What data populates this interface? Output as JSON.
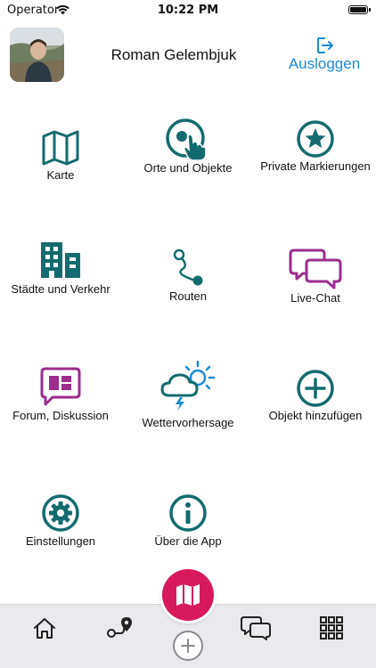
{
  "status_bar": {
    "carrier": "Operator",
    "time": "10:22 PM"
  },
  "header": {
    "user_name": "Roman Gelembjuk",
    "logout_label": "Ausloggen"
  },
  "colors": {
    "teal": "#146b6e",
    "purple": "#9b2d8e",
    "accent_blue": "#1c8ad9",
    "fab": "#d81a5c",
    "bar_bg": "#e9e9ee"
  },
  "menu": {
    "map": {
      "label": "Karte",
      "icon": "map-icon"
    },
    "places": {
      "label": "Orte und Objekte",
      "icon": "place-tap-icon"
    },
    "markers": {
      "label": "Private Markierungen",
      "icon": "star-icon"
    },
    "cities": {
      "label": "Städte und Verkehr",
      "icon": "buildings-icon"
    },
    "routes": {
      "label": "Routen",
      "icon": "route-icon"
    },
    "chat": {
      "label": "Live-Chat",
      "icon": "chat-icon"
    },
    "forum": {
      "label": "Forum, Diskussion",
      "icon": "forum-icon"
    },
    "weather": {
      "label": "Wettervorhersage",
      "icon": "weather-icon"
    },
    "add_object": {
      "label": "Objekt hinzufügen",
      "icon": "plus-circle-icon"
    },
    "settings": {
      "label": "Einstellungen",
      "icon": "gear-icon"
    },
    "about": {
      "label": "Über die App",
      "icon": "info-icon"
    }
  },
  "bottom_nav": [
    "home-icon",
    "route-pin-icon",
    "map-icon",
    "add-icon",
    "chat-icon",
    "grid-icon"
  ]
}
